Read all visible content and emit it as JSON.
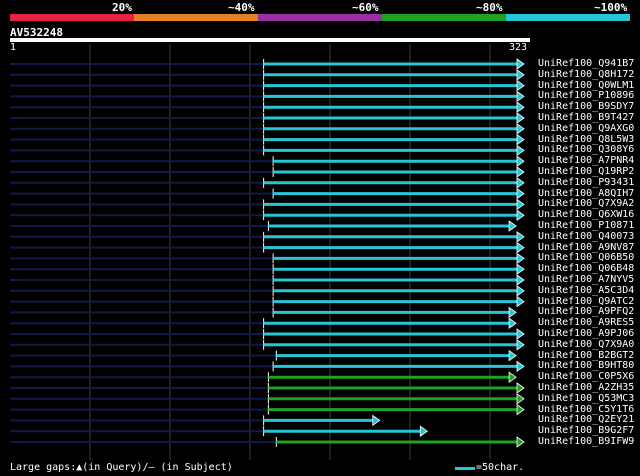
{
  "header": {
    "percent_labels": [
      "20%",
      "~40%",
      "~60%",
      "~80%",
      "~100%"
    ],
    "color_bar": [
      "#e8213f",
      "#e57d23",
      "#9c2fa3",
      "#1fa21f",
      "#27c6d6"
    ]
  },
  "query": {
    "title": "AV532248",
    "start_label": "1",
    "end_label": "323"
  },
  "colors": {
    "query_line": "#101a4a",
    "grid": "#3c3c3c",
    "hit_100": "#27c6d6",
    "hit_80": "#1fa21f",
    "gap_marker": "#ffffff"
  },
  "hits": [
    {
      "name": "UniRef100_Q941B7",
      "start": 160,
      "end": 323,
      "color": "cyan"
    },
    {
      "name": "UniRef100_Q8H172",
      "start": 160,
      "end": 323,
      "color": "cyan"
    },
    {
      "name": "UniRef100_Q0WLM1",
      "start": 160,
      "end": 323,
      "color": "cyan"
    },
    {
      "name": "UniRef100_P10896",
      "start": 160,
      "end": 323,
      "color": "cyan"
    },
    {
      "name": "UniRef100_B9SDY7",
      "start": 160,
      "end": 323,
      "color": "cyan"
    },
    {
      "name": "UniRef100_B9T427",
      "start": 160,
      "end": 323,
      "color": "cyan"
    },
    {
      "name": "UniRef100_Q9AXG0",
      "start": 160,
      "end": 323,
      "color": "cyan"
    },
    {
      "name": "UniRef100_Q8L5W3",
      "start": 160,
      "end": 323,
      "color": "cyan"
    },
    {
      "name": "UniRef100_Q308Y6",
      "start": 160,
      "end": 323,
      "color": "cyan"
    },
    {
      "name": "UniRef100_A7PNR4",
      "start": 166,
      "end": 323,
      "color": "cyan"
    },
    {
      "name": "UniRef100_Q19RP2",
      "start": 166,
      "end": 323,
      "color": "cyan"
    },
    {
      "name": "UniRef100_P93431",
      "start": 160,
      "end": 323,
      "color": "cyan"
    },
    {
      "name": "UniRef100_A8QIH7",
      "start": 166,
      "end": 323,
      "color": "cyan"
    },
    {
      "name": "UniRef100_Q7X9A2",
      "start": 160,
      "end": 323,
      "color": "cyan"
    },
    {
      "name": "UniRef100_Q6XW16",
      "start": 160,
      "end": 323,
      "color": "cyan"
    },
    {
      "name": "UniRef100_P10871",
      "start": 163,
      "end": 318,
      "color": "cyan"
    },
    {
      "name": "UniRef100_Q40073",
      "start": 160,
      "end": 323,
      "color": "cyan"
    },
    {
      "name": "UniRef100_A9NV87",
      "start": 160,
      "end": 323,
      "color": "cyan"
    },
    {
      "name": "UniRef100_Q06B50",
      "start": 166,
      "end": 323,
      "color": "cyan"
    },
    {
      "name": "UniRef100_Q06B48",
      "start": 166,
      "end": 323,
      "color": "cyan"
    },
    {
      "name": "UniRef100_A7NYV5",
      "start": 166,
      "end": 323,
      "color": "cyan"
    },
    {
      "name": "UniRef100_A5C3D4",
      "start": 166,
      "end": 323,
      "color": "cyan"
    },
    {
      "name": "UniRef100_Q9ATC2",
      "start": 166,
      "end": 323,
      "color": "cyan"
    },
    {
      "name": "UniRef100_A9PFQ2",
      "start": 166,
      "end": 318,
      "color": "cyan"
    },
    {
      "name": "UniRef100_A9RES5",
      "start": 160,
      "end": 318,
      "color": "cyan"
    },
    {
      "name": "UniRef100_A9PJ06",
      "start": 160,
      "end": 323,
      "color": "cyan"
    },
    {
      "name": "UniRef100_Q7X9A0",
      "start": 160,
      "end": 323,
      "color": "cyan"
    },
    {
      "name": "UniRef100_B2BGT2",
      "start": 168,
      "end": 318,
      "color": "cyan"
    },
    {
      "name": "UniRef100_B9HT80",
      "start": 166,
      "end": 323,
      "color": "cyan"
    },
    {
      "name": "UniRef100_C0P5X6",
      "start": 163,
      "end": 318,
      "color": "green"
    },
    {
      "name": "UniRef100_A2ZH35",
      "start": 163,
      "end": 323,
      "color": "green"
    },
    {
      "name": "UniRef100_Q53MC3",
      "start": 163,
      "end": 323,
      "color": "green"
    },
    {
      "name": "UniRef100_C5Y1T6",
      "start": 163,
      "end": 323,
      "color": "green"
    },
    {
      "name": "UniRef100_Q2EY21",
      "start": 160,
      "end": 232,
      "color": "cyan"
    },
    {
      "name": "UniRef100_B9G2F7",
      "start": 160,
      "end": 262,
      "color": "cyan"
    },
    {
      "name": "UniRef100_B9IFW9",
      "start": 168,
      "end": 323,
      "color": "green"
    }
  ],
  "footer": {
    "gap_legend": "Large gaps:▲(in Query)/— (in Subject)",
    "scale_legend": "=50char."
  }
}
